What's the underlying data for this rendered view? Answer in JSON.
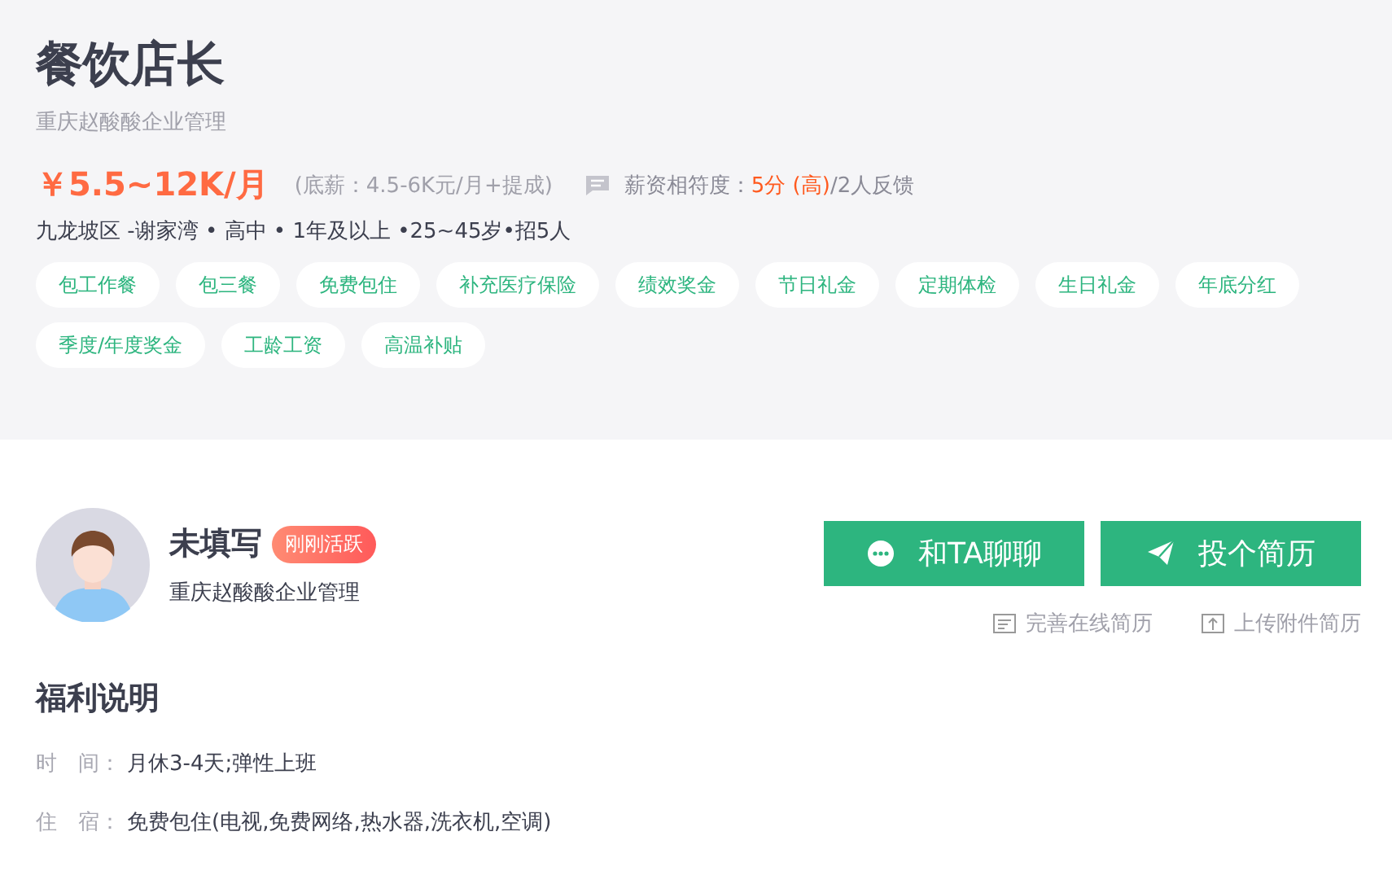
{
  "job": {
    "title": "餐饮店长",
    "company": "重庆赵酸酸企业管理",
    "salary": "￥5.5~12K/月",
    "base_salary": "(底薪：4.5-6K元/月+提成)",
    "match_label": "薪资相符度：",
    "match_score": "5分 (高)",
    "match_count": "/2人反馈",
    "details": "九龙坡区 -谢家湾 • 高中 • 1年及以上 •25~45岁•招5人",
    "tags": [
      "包工作餐",
      "包三餐",
      "免费包住",
      "补充医疗保险",
      "绩效奖金",
      "节日礼金",
      "定期体检",
      "生日礼金",
      "年底分红",
      "季度/年度奖金",
      "工龄工资",
      "高温补贴"
    ]
  },
  "recruiter": {
    "name": "未填写",
    "badge": "刚刚活跃",
    "company": "重庆赵酸酸企业管理"
  },
  "actions": {
    "chat": "和TA聊聊",
    "apply": "投个简历",
    "links": [
      {
        "kind": "doc",
        "label": "完善在线简历"
      },
      {
        "kind": "upload",
        "label": "上传附件简历"
      }
    ]
  },
  "benefits": {
    "title": "福利说明",
    "rows": [
      {
        "label": "时　间：",
        "value": "月休3-4天;弹性上班"
      },
      {
        "label": "住　宿：",
        "value": "免费包住(电视,免费网络,热水器,洗衣机,空调)"
      }
    ]
  }
}
